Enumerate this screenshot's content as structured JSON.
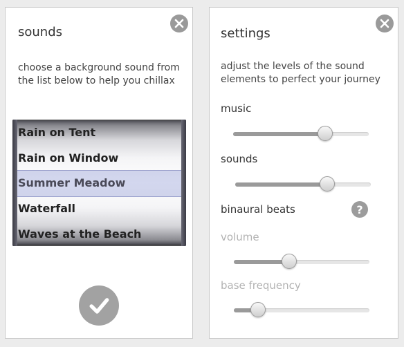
{
  "sounds_panel": {
    "title": "sounds",
    "description": "choose a background sound from the list below to help you chillax",
    "picker": {
      "items": [
        "Rain on Tent",
        "Rain on Window",
        "Summer Meadow",
        "Waterfall",
        "Waves at the Beach"
      ],
      "selected": "Summer Meadow"
    },
    "confirm_icon": "checkmark-icon",
    "close_icon": "close-icon"
  },
  "settings_panel": {
    "title": "settings",
    "description": "adjust the levels of the sound elements to perfect your journey",
    "music": {
      "label": "music",
      "level": 0.68
    },
    "sounds": {
      "label": "sounds",
      "level": 0.68
    },
    "binaural": {
      "label": "binaural beats",
      "help_symbol": "?"
    },
    "volume": {
      "label": "volume",
      "level": 0.41,
      "disabled": true
    },
    "base_frequency": {
      "label": "base frequency",
      "level": 0.18,
      "disabled": true
    },
    "close_icon": "close-icon"
  },
  "colors": {
    "panel_bg": "#ffffff",
    "page_bg": "#ececec",
    "icon_gray": "#9a9a9a",
    "disabled_text": "#b2b2b2",
    "selection_tint": "#8c96d2"
  }
}
